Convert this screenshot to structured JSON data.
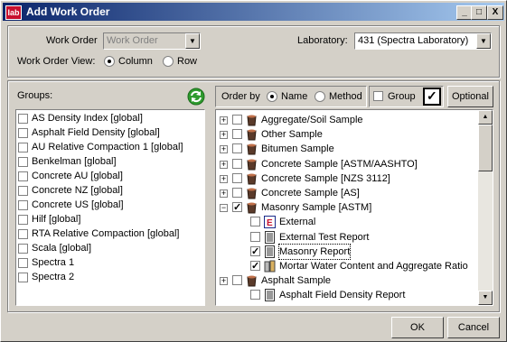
{
  "window": {
    "title": "Add Work Order",
    "app_icon": "lab",
    "min_glyph": "_",
    "max_glyph": "□",
    "close_glyph": "X"
  },
  "form": {
    "work_order_label": "Work Order",
    "work_order_value": "Work Order",
    "view_label": "Work Order View:",
    "view_column": "Column",
    "view_row": "Row",
    "laboratory_label": "Laboratory:",
    "laboratory_value": "431 (Spectra Laboratory)"
  },
  "groups": {
    "label": "Groups:",
    "items": [
      "AS Density Index [global]",
      "Asphalt Field Density [global]",
      "AU Relative Compaction 1 [global]",
      "Benkelman [global]",
      "Concrete AU [global]",
      "Concrete NZ [global]",
      "Concrete US [global]",
      "Hilf [global]",
      "RTA Relative Compaction [global]",
      "Scala [global]",
      "Spectra 1",
      "Spectra 2"
    ]
  },
  "toolbar": {
    "order_by": "Order by",
    "name": "Name",
    "method": "Method",
    "group": "Group",
    "optional": "Optional"
  },
  "tree": {
    "items": [
      {
        "label": "Aggregate/Soil Sample",
        "icon": "sample-bucket-icon",
        "checked": false
      },
      {
        "label": "Other Sample",
        "icon": "sample-bucket-icon",
        "checked": false
      },
      {
        "label": "Bitumen Sample",
        "icon": "sample-bucket-icon",
        "checked": false
      },
      {
        "label": "Concrete Sample [ASTM/AASHTO]",
        "icon": "sample-bucket-icon",
        "checked": false
      },
      {
        "label": "Concrete Sample [NZS 3112]",
        "icon": "sample-bucket-icon",
        "checked": false
      },
      {
        "label": "Concrete Sample [AS]",
        "icon": "sample-bucket-icon",
        "checked": false
      },
      {
        "label": "Masonry Sample [ASTM]",
        "icon": "sample-bucket-icon",
        "checked": true
      },
      {
        "label": "External",
        "icon": "external-e-icon",
        "checked": false
      },
      {
        "label": "External Test Report",
        "icon": "report-icon",
        "checked": false
      },
      {
        "label": "Masonry Report",
        "icon": "report-icon",
        "checked": true
      },
      {
        "label": "Mortar Water Content and Aggregate Ratio",
        "icon": "test-icon",
        "checked": true
      },
      {
        "label": "Asphalt Sample",
        "icon": "sample-bucket-icon",
        "checked": false
      },
      {
        "label": "Asphalt Field Density Report",
        "icon": "report-icon",
        "checked": false
      }
    ]
  },
  "buttons": {
    "ok": "OK",
    "cancel": "Cancel"
  },
  "colors": {
    "title_start": "#0a246a",
    "title_end": "#a6caf0",
    "face": "#d4d0c8",
    "refresh_green": "#2e9b2e"
  }
}
